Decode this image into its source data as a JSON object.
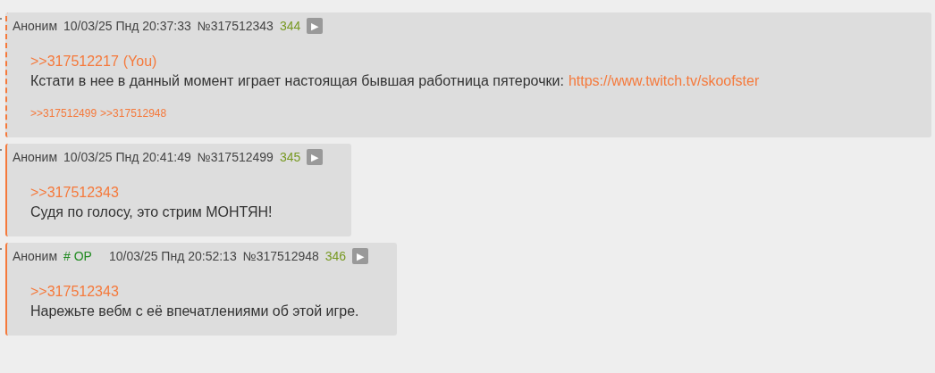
{
  "posts": [
    {
      "highlighted": true,
      "name": "Аноним",
      "op": false,
      "date": "10/03/25 Пнд 20:37:33",
      "number": "№317512343",
      "index": "344",
      "play": "▶",
      "quote": ">>317512217",
      "you": "(You)",
      "body": "Кстати в нее в данный момент играет настоящая бывшая работница пятерочки:",
      "link": "https://www.twitch.tv/skoofster",
      "replies": [
        ">>317512499",
        ">>317512948"
      ]
    },
    {
      "highlighted": false,
      "name": "Аноним",
      "op": false,
      "date": "10/03/25 Пнд 20:41:49",
      "number": "№317512499",
      "index": "345",
      "play": "▶",
      "quote": ">>317512343",
      "body": "Судя по голосу, это стрим МОНТЯН!"
    },
    {
      "highlighted": false,
      "name": "Аноним",
      "op": true,
      "op_label": "# OP",
      "date": "10/03/25 Пнд 20:52:13",
      "number": "№317512948",
      "index": "346",
      "play": "▶",
      "quote": ">>317512343",
      "body": "Нарежьте вебм с её впечатлениями об этой игре."
    }
  ]
}
